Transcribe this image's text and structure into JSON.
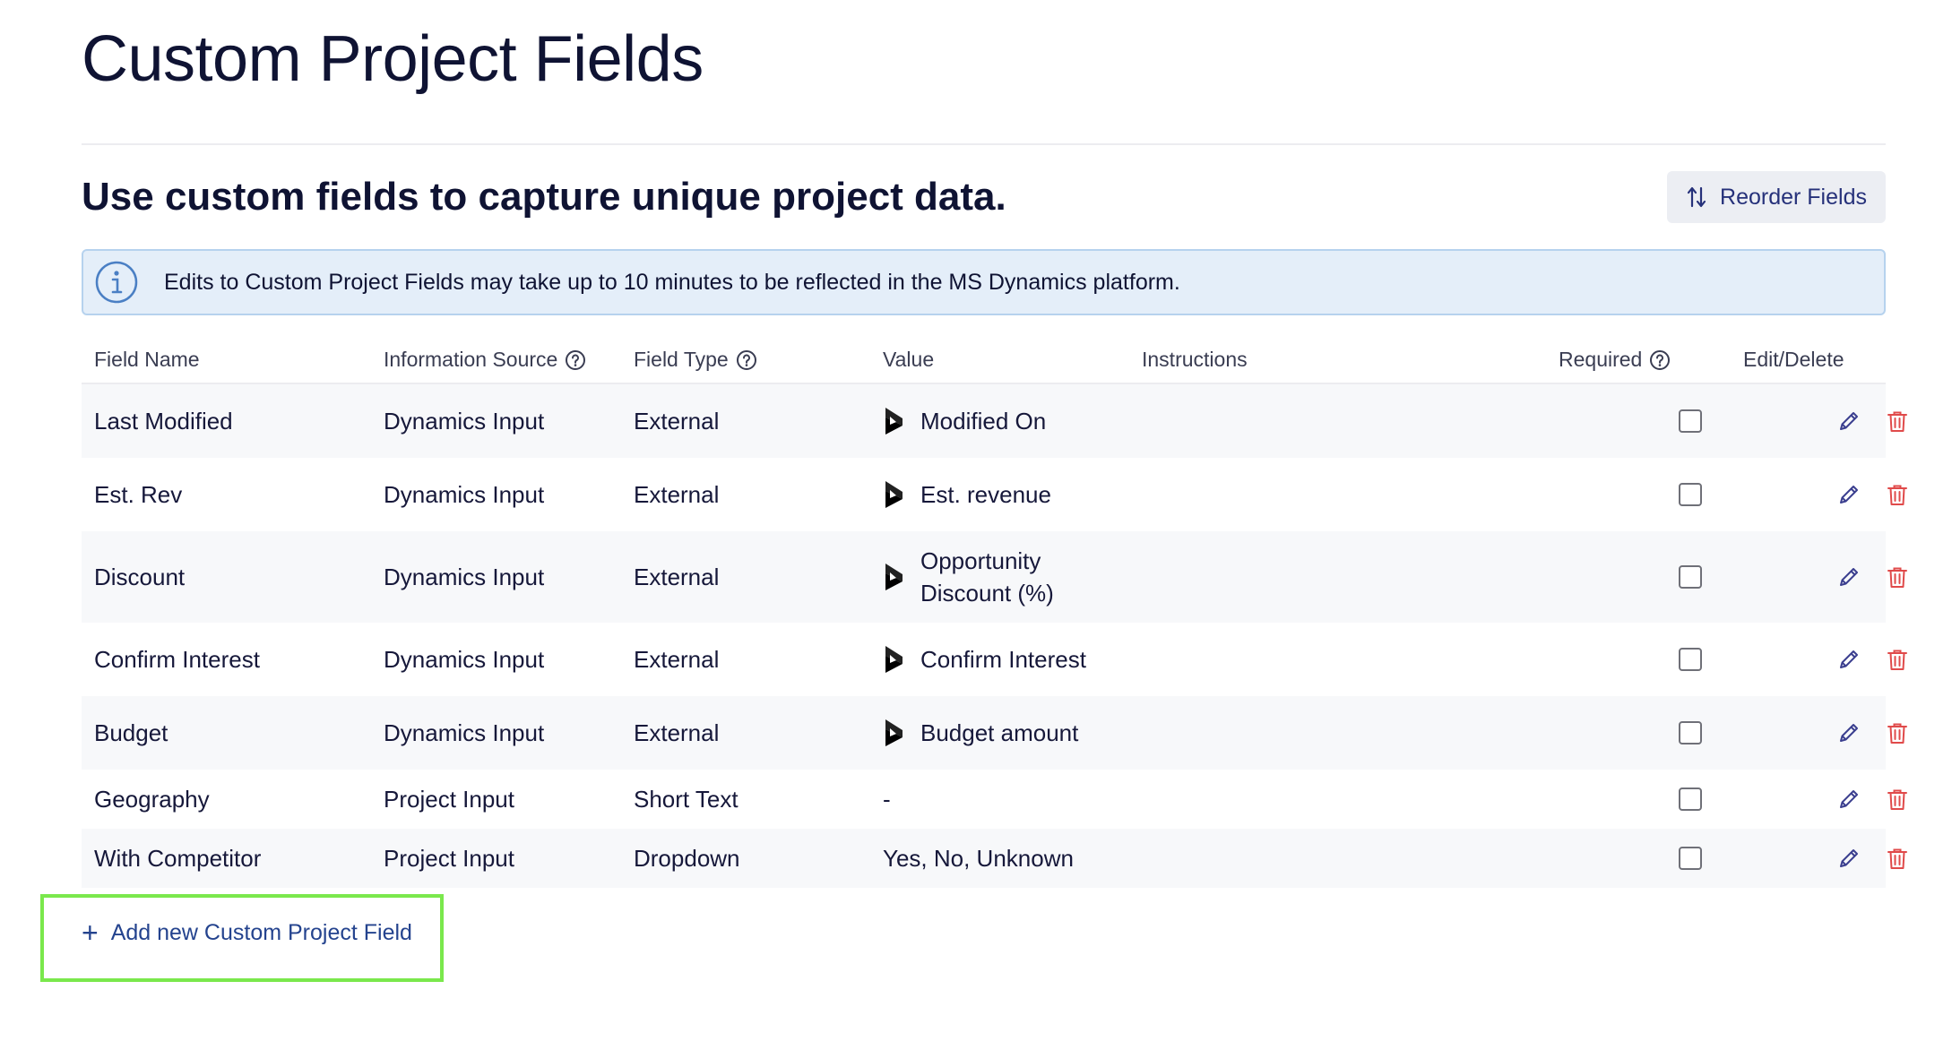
{
  "page": {
    "title": "Custom Project Fields",
    "subtitle": "Use custom fields to capture unique project data.",
    "reorder_label": "Reorder Fields"
  },
  "banner": {
    "icon": "info-icon",
    "text": "Edits to Custom Project Fields may take up to 10 minutes to be reflected in the MS Dynamics platform."
  },
  "table": {
    "headers": {
      "field_name": "Field Name",
      "info_source": "Information Source",
      "field_type": "Field Type",
      "value": "Value",
      "instructions": "Instructions",
      "required": "Required",
      "edit_delete": "Edit/Delete"
    },
    "rows": [
      {
        "name": "Last Modified",
        "source": "Dynamics Input",
        "type": "External",
        "value": "Modified On",
        "dynamics": true,
        "required": false
      },
      {
        "name": "Est. Rev",
        "source": "Dynamics Input",
        "type": "External",
        "value": "Est. revenue",
        "dynamics": true,
        "required": false
      },
      {
        "name": "Discount",
        "source": "Dynamics Input",
        "type": "External",
        "value_line1": "Opportunity",
        "value_line2": "Discount (%)",
        "dynamics": true,
        "required": false
      },
      {
        "name": "Confirm Interest",
        "source": "Dynamics Input",
        "type": "External",
        "value": "Confirm Interest",
        "dynamics": true,
        "required": false
      },
      {
        "name": "Budget",
        "source": "Dynamics Input",
        "type": "External",
        "value": "Budget amount",
        "dynamics": true,
        "required": false
      },
      {
        "name": "Geography",
        "source": "Project Input",
        "type": "Short Text",
        "value": "-",
        "dynamics": false,
        "required": false
      },
      {
        "name": "With Competitor",
        "source": "Project Input",
        "type": "Dropdown",
        "value": "Yes, No, Unknown",
        "dynamics": false,
        "required": false
      }
    ]
  },
  "add_field": {
    "label": "Add new Custom Project Field",
    "icon": "plus-icon"
  },
  "colors": {
    "accent": "#26317a",
    "banner_bg": "#e4eef9",
    "banner_border": "#b6d2ee",
    "delete": "#e04a4a",
    "edit": "#3b3f8f",
    "highlight": "#7ae84c"
  }
}
